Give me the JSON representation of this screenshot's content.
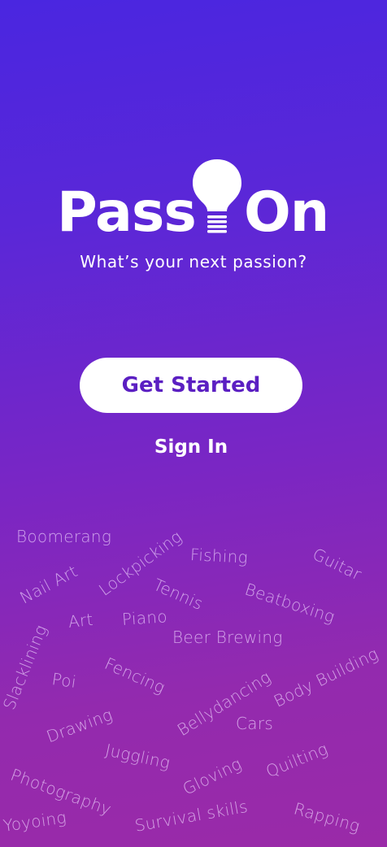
{
  "logo": {
    "left_text": "Pass",
    "right_text": "On"
  },
  "tagline": "What’s your next passion?",
  "actions": {
    "get_started": "Get Started",
    "sign_in": "Sign In"
  },
  "hobbies": [
    "Boomerang",
    "Lockpicking",
    "Fishing",
    "Guitar",
    "Nail Art",
    "Tennis",
    "Beatboxing",
    "Art",
    "Piano",
    "Beer Brewing",
    "Slacklining",
    "Poi",
    "Fencing",
    "Bellydancing",
    "Body Building",
    "Drawing",
    "Cars",
    "Juggling",
    "Photography",
    "Gloving",
    "Quilting",
    "Yoyoing",
    "Survival skills",
    "Rapping"
  ],
  "colors": {
    "gradient_top": "#4a26e0",
    "gradient_bottom": "#9a2aa8",
    "button_bg": "#ffffff",
    "button_text": "#5b1fc2"
  },
  "icons": {
    "logo_bulb": "lightbulb-icon"
  }
}
